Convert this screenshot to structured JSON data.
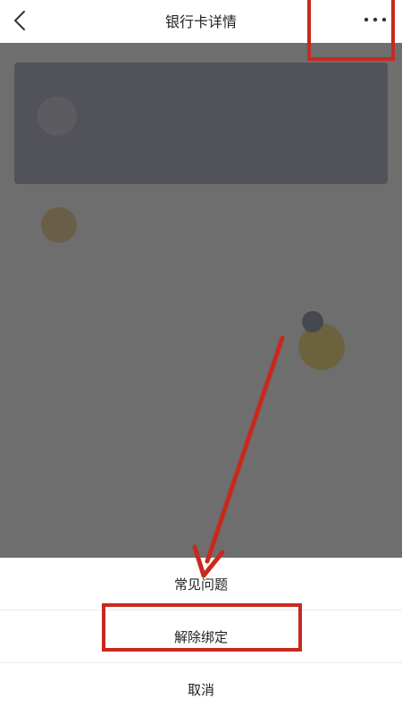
{
  "navbar": {
    "title": "银行卡详情",
    "back_icon": "chevron-left-icon",
    "more_icon": "more-dots-icon"
  },
  "action_sheet": {
    "items": [
      {
        "label": "常见问题"
      },
      {
        "label": "解除绑定"
      },
      {
        "label": "取消"
      }
    ]
  },
  "colors": {
    "annotation_red": "#c8291f",
    "overlay": "rgba(0,0,0,0.55)",
    "card_bg": "#b7b7c7"
  }
}
